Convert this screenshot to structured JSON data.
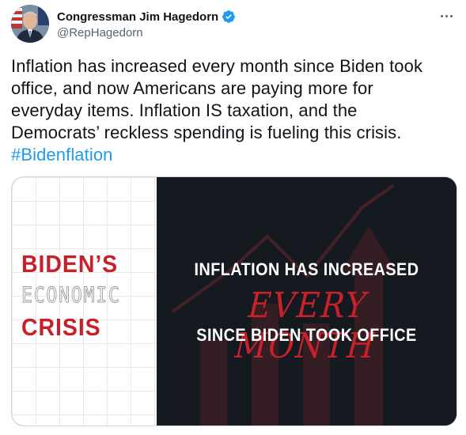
{
  "author": {
    "display_name": "Congressman Jim Hagedorn",
    "handle": "@RepHagedorn",
    "verified": true,
    "verified_color": "#1d9bf0"
  },
  "tweet": {
    "text_lines": [
      "Inflation has increased every month since Biden took",
      "office, and now Americans are paying more for",
      "everyday items. Inflation IS taxation, and the",
      "Democrats’ reckless spending is fueling this crisis."
    ],
    "hashtag": "#Bidenflation"
  },
  "media": {
    "left_lines": [
      "BIDEN’S",
      "ECONOMIC",
      "CRISIS"
    ],
    "right_line1": "INFLATION HAS INCREASED",
    "right_line2": "EVERY MONTH",
    "right_line3": "SINCE BIDEN TOOK OFFICE"
  },
  "colors": {
    "accent_red": "#c8202a",
    "link_blue": "#1d9bf0",
    "text_primary": "#0f1419",
    "text_secondary": "#536471"
  },
  "icons": {
    "verified": "verified-badge-icon",
    "more": "more-options-icon"
  }
}
